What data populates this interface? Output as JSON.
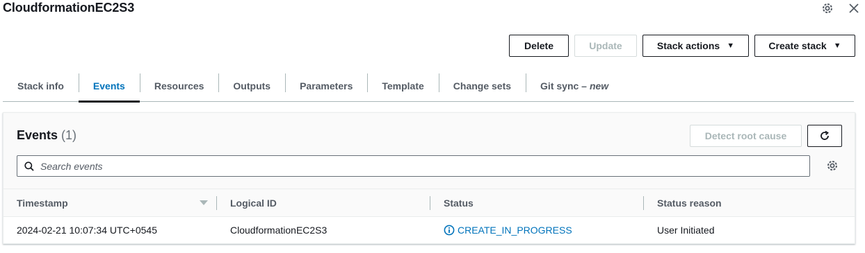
{
  "stack": {
    "title": "CloudformationEC2S3"
  },
  "actions": {
    "delete": "Delete",
    "update": "Update",
    "stack_actions": "Stack actions",
    "create_stack": "Create stack"
  },
  "tabs": [
    {
      "label": "Stack info"
    },
    {
      "label": "Events"
    },
    {
      "label": "Resources"
    },
    {
      "label": "Outputs"
    },
    {
      "label": "Parameters"
    },
    {
      "label": "Template"
    },
    {
      "label": "Change sets"
    },
    {
      "label": "Git sync –",
      "badge": "new"
    }
  ],
  "events": {
    "title": "Events",
    "count": "(1)",
    "detect_root_cause": "Detect root cause",
    "search_placeholder": "Search events",
    "columns": [
      "Timestamp",
      "Logical ID",
      "Status",
      "Status reason"
    ],
    "rows": [
      {
        "timestamp": "2024-02-21 10:07:34 UTC+0545",
        "logical_id": "CloudformationEC2S3",
        "status": "CREATE_IN_PROGRESS",
        "status_reason": "User Initiated"
      }
    ]
  },
  "colors": {
    "accent": "#0073bb",
    "text": "#16191f",
    "muted": "#545b64",
    "disabled": "#aab7b8"
  },
  "icons": [
    "gear-icon",
    "close-icon",
    "caret-down-icon",
    "refresh-icon",
    "search-icon",
    "info-icon",
    "sort-down-icon"
  ]
}
